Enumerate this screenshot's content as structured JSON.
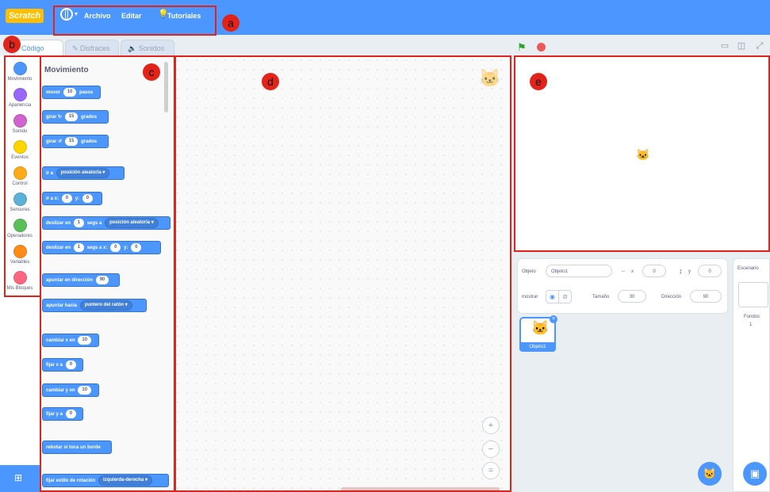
{
  "menubar": {
    "logo": "Scratch",
    "caret": "▾",
    "file": "Archivo",
    "edit": "Editar",
    "tutorials": "Tutoriales"
  },
  "tabs": {
    "code": "Código",
    "costumes": "Disfraces",
    "sounds": "Sonidos"
  },
  "categories": [
    {
      "label": "Movimiento",
      "color": "#4c97ff"
    },
    {
      "label": "Apariencia",
      "color": "#9966ff"
    },
    {
      "label": "Sonido",
      "color": "#cf63cf"
    },
    {
      "label": "Eventos",
      "color": "#ffd500"
    },
    {
      "label": "Control",
      "color": "#ffab19"
    },
    {
      "label": "Sensores",
      "color": "#5cb1d6"
    },
    {
      "label": "Operadores",
      "color": "#59c059"
    },
    {
      "label": "Variables",
      "color": "#ff8c1a"
    },
    {
      "label": "Mis Bloques",
      "color": "#ff6680"
    }
  ],
  "palette": {
    "title": "Movimiento",
    "blocks": {
      "move": {
        "text": "mover",
        "value": "10",
        "suffix": "pasos"
      },
      "turn_right": {
        "text": "girar",
        "icon": "↻",
        "value": "15",
        "suffix": "grados"
      },
      "turn_left": {
        "text": "girar",
        "icon": "↺",
        "value": "15",
        "suffix": "grados"
      },
      "goto": {
        "text": "ir a",
        "dropdown": "posición aleatoria ▾"
      },
      "goto_xy": {
        "text": "ir a x:",
        "x": "0",
        "ylabel": "y:",
        "y": "0"
      },
      "glide_to": {
        "text": "deslizar en",
        "value": "1",
        "mid": "segs a",
        "dropdown": "posición aleatoria ▾"
      },
      "glide_xy": {
        "text": "deslizar en",
        "value": "1",
        "mid": "segs a x:",
        "x": "0",
        "ylabel": "y:",
        "y": "0"
      },
      "point_dir": {
        "text": "apuntar en dirección",
        "value": "90"
      },
      "point_towards": {
        "text": "apuntar hacia",
        "dropdown": "puntero del ratón ▾"
      },
      "change_x": {
        "text": "cambiar x en",
        "value": "10"
      },
      "set_x": {
        "text": "fijar x a",
        "value": "0"
      },
      "change_y": {
        "text": "cambiar y en",
        "value": "10"
      },
      "set_y": {
        "text": "fijar y a",
        "value": "0"
      },
      "bounce": {
        "text": "rebotar si toca un borde"
      },
      "rotation_style": {
        "text": "fijar estilo de rotación",
        "dropdown": "izquierda-derecha ▾"
      }
    }
  },
  "annotations": [
    "a",
    "b",
    "c",
    "d",
    "e"
  ],
  "zoom": {
    "in": "+",
    "out": "−",
    "reset": "="
  },
  "sprite_info": {
    "sprite_label": "Objeto",
    "sprite_name": "Objeto1",
    "x_label": "x",
    "x_value": "0",
    "y_label": "y",
    "y_value": "0",
    "show_label": "mostrar",
    "size_label": "Tamaño",
    "size_value": "30",
    "direction_label": "Dirección",
    "direction_value": "90"
  },
  "sprite_list": [
    {
      "name": "Objeto1"
    }
  ],
  "stage_col": {
    "title": "Escenario",
    "backdrops_label": "Fondos",
    "backdrops_count": "1"
  },
  "colors": {
    "menubar": "#4c97ff",
    "annotation": "#e2231a",
    "motion": "#4c97ff"
  },
  "icons": {
    "language": "globe-icon",
    "tutorials": "lightbulb-icon",
    "green_flag": "green-flag-icon",
    "stop": "stop-icon",
    "sprite": "cat-sprite-icon",
    "add_sprite": "add-sprite-icon",
    "add_backdrop": "add-backdrop-icon",
    "extensions": "add-extension-icon"
  }
}
